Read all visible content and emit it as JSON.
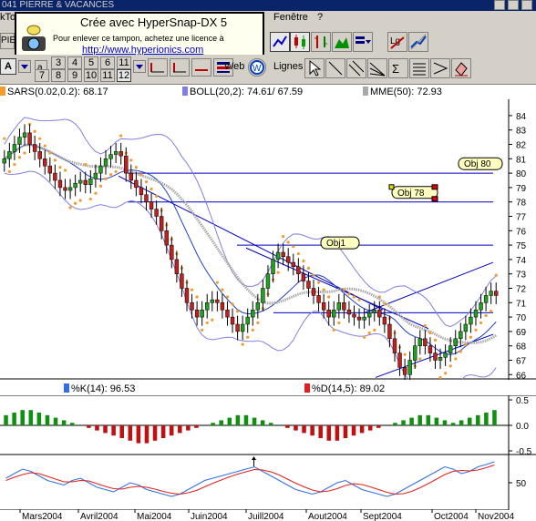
{
  "titlebar": {
    "text": "041 PIERRE & VACANCES"
  },
  "menubar": {
    "items": [
      "kTo",
      "Fenêtre",
      "?"
    ]
  },
  "watermark": {
    "line1": "Crée avec HyperSnap-DX 5",
    "line2": "Pour enlever ce tampon, achetez une licence à",
    "url": "http://www.hyperionics.com"
  },
  "toolbar": {
    "symbol": "PIE",
    "mode_letter": "A",
    "periods_top": [
      "3",
      "4",
      "5",
      "6",
      "11"
    ],
    "periods_bottom": [
      "7",
      "8",
      "9",
      "10",
      "11",
      "12"
    ],
    "web_label": "Web",
    "lines_label": "Lignes"
  },
  "legend": {
    "sar": "SARS(0.02,0.2): 68.17",
    "boll": "BOLL(20,2): 74.61/ 67.59",
    "mme": "MME(50): 72.93",
    "k": "%K(14): 96.53",
    "d": "%D(14,5): 89.02"
  },
  "colors": {
    "sar": "#f29a2e",
    "boll": "#8080e0",
    "mme": "#a8a8a8",
    "k": "#3070e0",
    "d": "#e02020",
    "candle_up": "#20a020",
    "candle_down": "#c02020"
  },
  "price_axis": [
    "84",
    "83",
    "82",
    "81",
    "80",
    "79",
    "78",
    "77",
    "76",
    "75",
    "74",
    "73",
    "72",
    "71",
    "70",
    "69",
    "68",
    "67",
    "66"
  ],
  "macd_axis": [
    "0.5",
    "0.0",
    "-0.5"
  ],
  "stoch_axis": [
    "50"
  ],
  "annotations": {
    "obj80": "Obj 80",
    "obj78": "Obj 78",
    "obj1": "Obj1"
  },
  "x_axis": [
    "Mars2004",
    "Avril2004",
    "Mai2004",
    "Juin2004",
    "Juill2004",
    "Aout2004",
    "Sept2004",
    "Oct2004",
    "Nov2004"
  ],
  "chart_data": {
    "type": "candlestick",
    "ylim": [
      65,
      84.5
    ],
    "horizontal_levels": [
      80,
      78,
      75,
      70.3
    ],
    "price": [
      81,
      81.5,
      82,
      82.5,
      82.8,
      82,
      81.5,
      81,
      80.5,
      80,
      79.5,
      79,
      78.8,
      79,
      79.3,
      79.5,
      79.2,
      79.6,
      80,
      80.5,
      81,
      81.3,
      81.5,
      81.2,
      80,
      79.5,
      79,
      78.5,
      78,
      77.5,
      77,
      76,
      75,
      74,
      73,
      72,
      71,
      70.5,
      70,
      70.5,
      71,
      71.2,
      71,
      70.5,
      70,
      69.5,
      69,
      69.5,
      70,
      70.5,
      71,
      72,
      73,
      74,
      74.5,
      74.2,
      73.8,
      73.5,
      73,
      72.5,
      72,
      71.5,
      71,
      70.5,
      70,
      70.5,
      71,
      70.5,
      70.2,
      70,
      69.8,
      70,
      70.3,
      70.5,
      70,
      69.5,
      68.5,
      67.5,
      66.5,
      66,
      67,
      68,
      68.5,
      68,
      67.5,
      67,
      67.2,
      67.5,
      68,
      68.5,
      69,
      69.5,
      70,
      70.5,
      71,
      71.5,
      71.8,
      71.5
    ],
    "macd_hist": [
      0.2,
      0.25,
      0.3,
      0.3,
      0.25,
      0.2,
      0.15,
      0.1,
      0.05,
      0,
      -0.05,
      -0.1,
      -0.15,
      -0.2,
      -0.25,
      -0.3,
      -0.35,
      -0.35,
      -0.3,
      -0.25,
      -0.2,
      -0.15,
      -0.1,
      -0.05,
      0,
      0.05,
      0.1,
      0.15,
      0.2,
      0.2,
      0.15,
      0.1,
      0.05,
      0,
      -0.05,
      -0.1,
      -0.15,
      -0.2,
      -0.25,
      -0.3,
      -0.3,
      -0.25,
      -0.2,
      -0.15,
      -0.1,
      -0.05,
      0,
      0.05,
      0.1,
      0.15,
      0.2,
      0.2,
      0.15,
      0.1,
      0.05,
      0.1,
      0.15,
      0.2,
      0.25,
      0.3
    ],
    "stoch_k": [
      60,
      70,
      80,
      75,
      65,
      55,
      50,
      45,
      55,
      60,
      50,
      40,
      35,
      30,
      40,
      50,
      45,
      35,
      30,
      25,
      20,
      25,
      35,
      45,
      55,
      60,
      65,
      70,
      75,
      80,
      85,
      75,
      65,
      55,
      45,
      35,
      30,
      25,
      30,
      40,
      50,
      55,
      45,
      35,
      30,
      25,
      20,
      25,
      35,
      45,
      55,
      65,
      75,
      85,
      80,
      70,
      75,
      85,
      90,
      96
    ],
    "stoch_d": [
      55,
      62,
      68,
      72,
      70,
      64,
      58,
      52,
      52,
      55,
      54,
      48,
      42,
      37,
      36,
      40,
      42,
      40,
      36,
      31,
      27,
      25,
      28,
      33,
      41,
      49,
      56,
      63,
      69,
      74,
      79,
      78,
      74,
      67,
      58,
      49,
      41,
      34,
      30,
      32,
      37,
      44,
      48,
      46,
      41,
      35,
      29,
      25,
      26,
      31,
      39,
      48,
      58,
      68,
      75,
      77,
      76,
      78,
      83,
      89
    ]
  }
}
